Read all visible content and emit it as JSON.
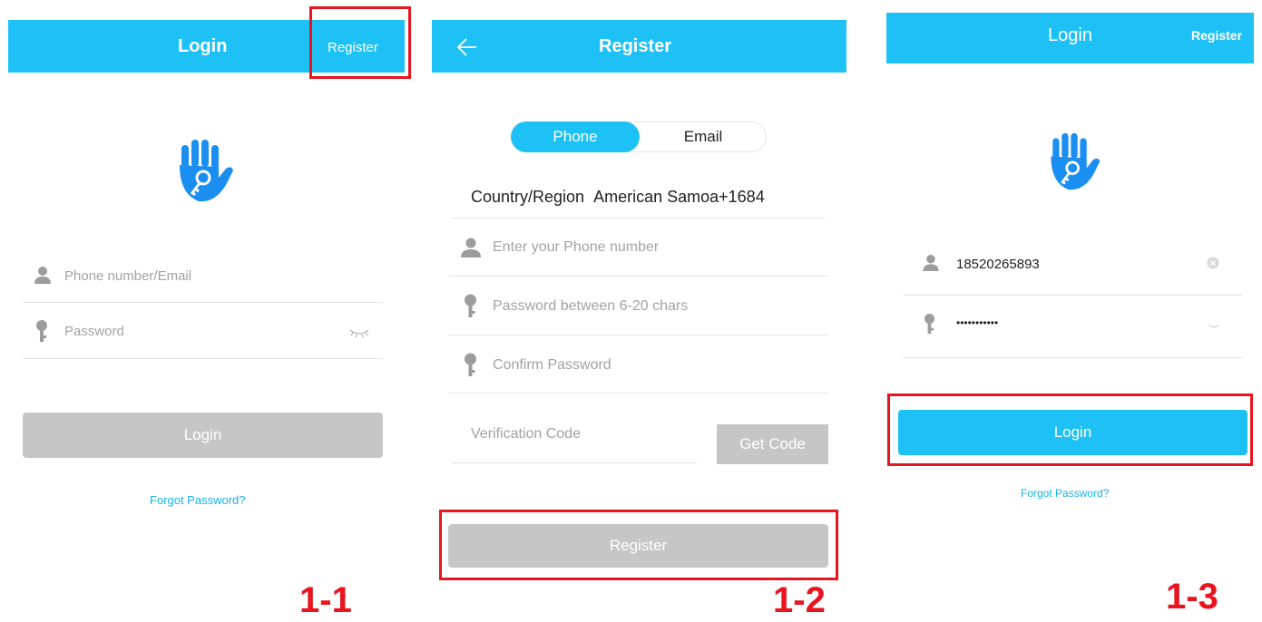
{
  "panel1": {
    "title": "Login",
    "register_link": "Register",
    "username_placeholder": "Phone number/Email",
    "password_placeholder": "Password",
    "login_button": "Login",
    "forgot_password": "Forgot Password?",
    "step_label": "1-1"
  },
  "panel2": {
    "title": "Register",
    "tabs": [
      "Phone",
      "Email"
    ],
    "country_label": "Country/Region",
    "country_value": "American Samoa+1684",
    "phone_placeholder": "Enter your Phone number",
    "password_placeholder": "Password between 6-20 chars",
    "confirm_placeholder": "Confirm Password",
    "verification_placeholder": "Verification Code",
    "get_code_button": "Get Code",
    "register_button": "Register",
    "step_label": "1-2"
  },
  "panel3": {
    "title": "Login",
    "register_link": "Register",
    "username_value": "18520265893",
    "password_value": "•••••••••••",
    "login_button": "Login",
    "forgot_password": "Forgot Password?",
    "step_label": "1-3"
  },
  "colors": {
    "header_blue": "#1ec1f5",
    "highlight_red": "#e8141e",
    "disabled_grey": "#c6c6c6",
    "icon_blue": "#1b8ef2"
  }
}
